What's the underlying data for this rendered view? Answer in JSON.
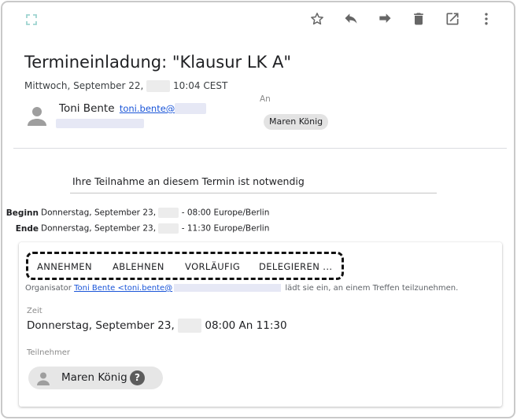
{
  "header": {
    "subject": "Termineinladung: \"Klausur LK A\"",
    "date_prefix": "Mittwoch, September 22,",
    "date_suffix": "10:04 CEST"
  },
  "toolbar": {
    "icons": [
      "expand-icon",
      "star-icon",
      "reply-icon",
      "forward-icon",
      "delete-icon",
      "open-external-icon",
      "more-vert-icon"
    ]
  },
  "sender": {
    "name": "Toni Bente",
    "email_visible": "toni.bente@"
  },
  "recipients": {
    "label": "An",
    "chips": [
      "Maren König"
    ]
  },
  "invite": {
    "required_note": "Ihre Teilnahme an diesem Termin ist notwendig",
    "begin_label": "Beginn",
    "begin_prefix": "Donnerstag, September 23,",
    "begin_suffix": "- 08:00 Europe/Berlin",
    "end_label": "Ende",
    "end_prefix": "Donnerstag, September 23,",
    "end_suffix": "- 11:30 Europe/Berlin"
  },
  "card": {
    "actions": [
      "ANNEHMEN",
      "ABLEHNEN",
      "VORLÄUFIG",
      "DELEGIEREN ..."
    ],
    "organizer_label": "Organisator",
    "organizer_link": "Toni Bente <toni.bente@",
    "organizer_suffix": "lädt sie ein, an einem Treffen teilzunehmen.",
    "time_label": "Zeit",
    "time_prefix": "Donnerstag, September 23,",
    "time_suffix": "08:00 An 11:30",
    "participants_label": "Teilnehmer",
    "participant_name": "Maren König",
    "participant_help": "?"
  },
  "colors": {
    "accent_link": "#1a55d8",
    "chip_bg": "#e3e3e3",
    "icon_gray": "#666666",
    "expand_icon": "#9fd4d0"
  }
}
